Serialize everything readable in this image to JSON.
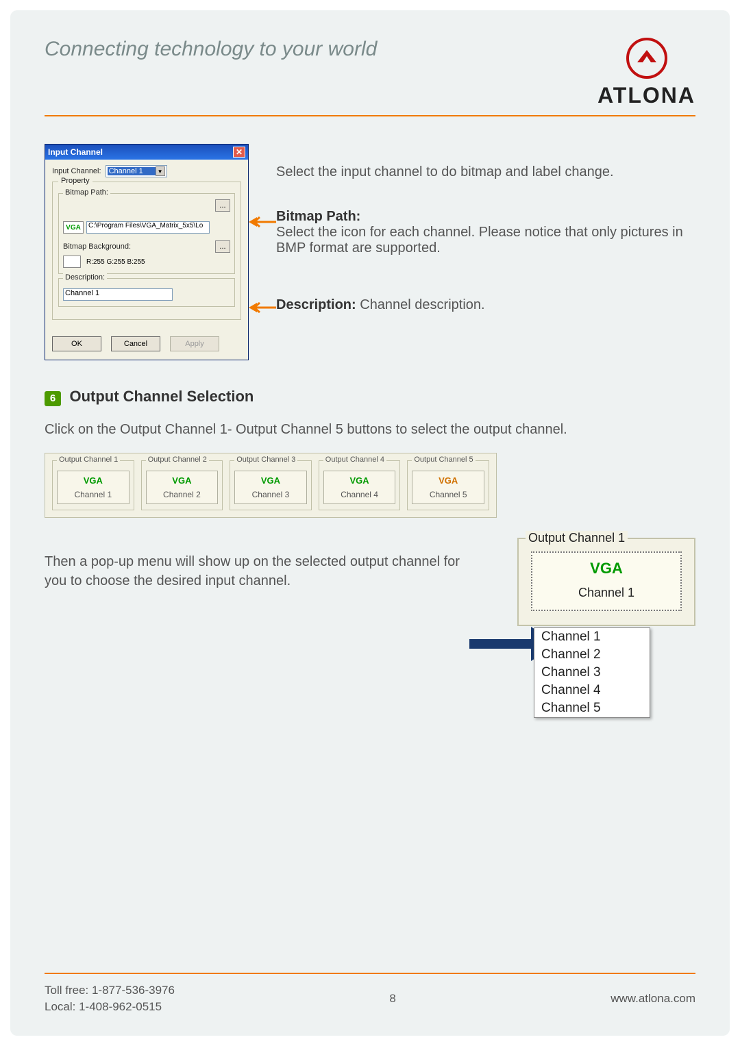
{
  "header": {
    "tagline": "Connecting technology to your world",
    "brand": "ATLONA"
  },
  "dialog": {
    "title": "Input Channel",
    "input_channel_label": "Input Channel:",
    "input_channel_value": "Channel 1",
    "property_legend": "Property",
    "bitmap_path_label": "Bitmap Path:",
    "bitmap_swatch": "VGA",
    "bitmap_path_value": "C:\\Program Files\\VGA_Matrix_5x5\\Lo",
    "browse": "...",
    "bitmap_bg_label": "Bitmap Background:",
    "rgb_text": "R:255  G:255  B:255",
    "description_label": "Description:",
    "description_value": "Channel 1",
    "ok": "OK",
    "cancel": "Cancel",
    "apply": "Apply"
  },
  "annot": {
    "select_text": "Select the input channel to do bitmap and label change.",
    "bitmap_title": "Bitmap Path:",
    "bitmap_text": "Select the icon for each channel. Please notice that only pictures in BMP format are supported.",
    "desc_title": "Description:",
    "desc_text": " Channel description."
  },
  "section6": {
    "num": "6",
    "title": "Output Channel Selection",
    "intro": "Click on the Output Channel 1- Output Channel 5 buttons to select the output channel.",
    "after": "Then a pop-up menu will show up on the selected output channel for you to choose the desired input channel."
  },
  "out_strip": {
    "items": [
      {
        "legend": "Output Channel 1",
        "vga": "VGA",
        "ch": "Channel 1",
        "sel": false
      },
      {
        "legend": "Output Channel 2",
        "vga": "VGA",
        "ch": "Channel 2",
        "sel": false
      },
      {
        "legend": "Output Channel 3",
        "vga": "VGA",
        "ch": "Channel 3",
        "sel": false
      },
      {
        "legend": "Output Channel 4",
        "vga": "VGA",
        "ch": "Channel 4",
        "sel": false
      },
      {
        "legend": "Output Channel 5",
        "vga": "VGA",
        "ch": "Channel 5",
        "sel": true
      }
    ]
  },
  "popup": {
    "legend": "Output Channel 1",
    "vga": "VGA",
    "ch": "Channel 1",
    "menu": [
      "Channel 1",
      "Channel 2",
      "Channel 3",
      "Channel 4",
      "Channel 5"
    ]
  },
  "footer": {
    "tollfree": "Toll free: 1-877-536-3976",
    "local": "Local: 1-408-962-0515",
    "page": "8",
    "url": "www.atlona.com"
  }
}
